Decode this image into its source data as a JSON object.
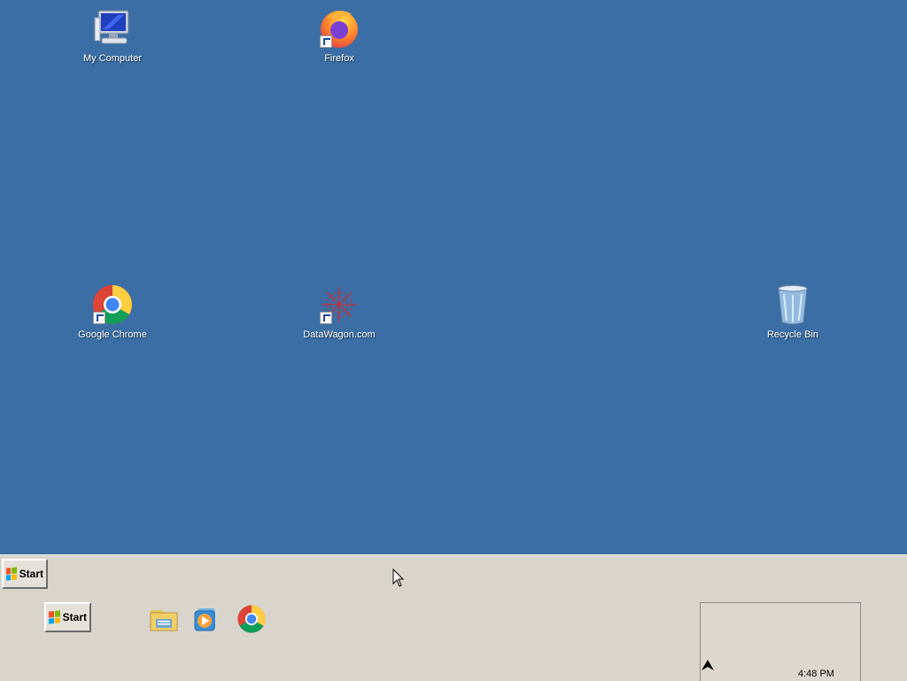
{
  "desktop": {
    "icons": [
      {
        "label": "My Computer",
        "icon": "computer-icon"
      },
      {
        "label": "Firefox",
        "icon": "firefox-icon"
      },
      {
        "label": "Google Chrome",
        "icon": "chrome-icon"
      },
      {
        "label": "DataWagon.com",
        "icon": "datawagon-icon"
      },
      {
        "label": "Recycle Bin",
        "icon": "recycle-bin-icon"
      }
    ]
  },
  "taskbar": {
    "start_label_top": "Start",
    "start_label_bottom": "Start",
    "quick_launch": [
      "file-explorer-icon",
      "media-player-icon",
      "chrome-icon"
    ],
    "clock": "4:48 PM"
  },
  "colors": {
    "desktop": "#3a6ea5",
    "taskbar": "#d9d5cc"
  }
}
